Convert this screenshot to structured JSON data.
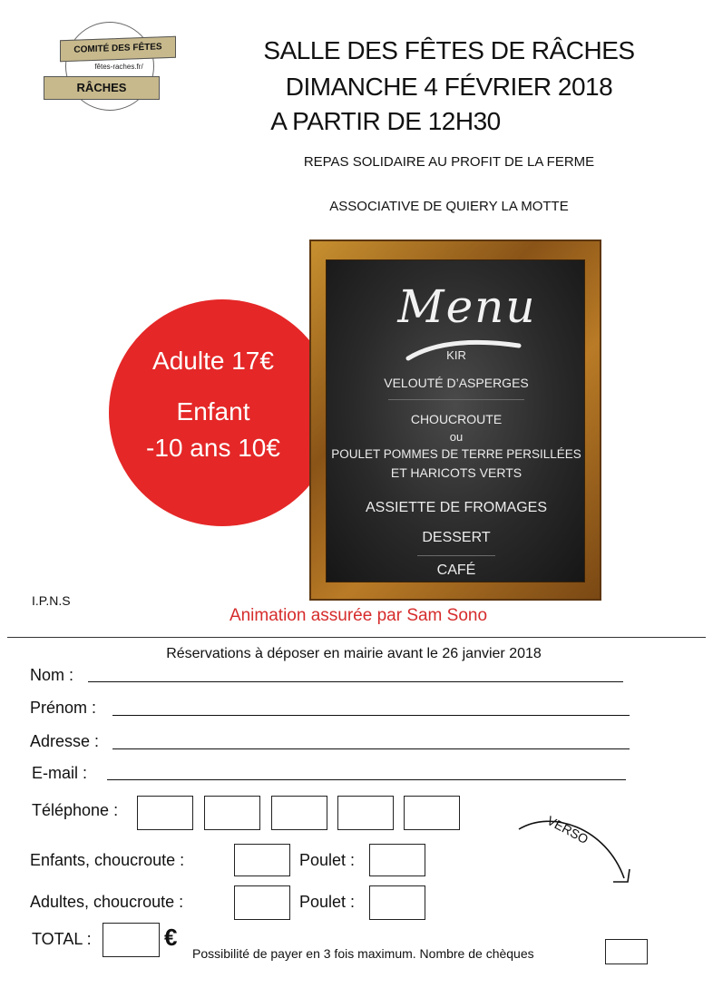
{
  "logo": {
    "top_text": "COMITÉ DES FÊTES",
    "url": "fêtes-raches.fr/",
    "bottom_text": "RÂCHES"
  },
  "header": {
    "line1": "SALLE DES FÊTES DE RÂCHES",
    "line2": "DIMANCHE 4 FÉVRIER 2018",
    "line3": "A PARTIR DE 12H30",
    "sub1": "REPAS SOLIDAIRE AU PROFIT DE LA FERME",
    "sub2": "ASSOCIATIVE DE QUIERY LA MOTTE"
  },
  "prices": {
    "adult": "Adulte 17€",
    "child_line1": "Enfant",
    "child_line2": "-10 ans  10€",
    "circle_color": "#e52727"
  },
  "menu": {
    "title": "Menu",
    "kir": "KIR",
    "veloute": "VELOUTÉ D’ASPERGES",
    "choucroute": "CHOUCROUTE",
    "ou": "ou",
    "poulet": "POULET POMMES DE TERRE PERSILLÉES",
    "haricots": "ET HARICOTS VERTS",
    "fromages": "ASSIETTE DE FROMAGES",
    "dessert": "DESSERT",
    "cafe": "CAFÉ"
  },
  "ipns": "I.P.N.S",
  "animation": "Animation assurée par Sam Sono",
  "form": {
    "reservation_note": "Réservations à déposer en mairie avant le 26  janvier 2018",
    "nom_label": "Nom :",
    "prenom_label": "Prénom :",
    "adresse_label": "Adresse :",
    "email_label": "E-mail :",
    "telephone_label": "Téléphone :",
    "enfants_label": "Enfants, choucroute :",
    "adultes_label": "Adultes, choucroute :",
    "poulet_label": "Poulet :",
    "total_label": "TOTAL :",
    "euro_symbol": "€",
    "cheques_note": "Possibilité de payer en 3 fois maximum. Nombre de chèques",
    "verso": "VERSO"
  }
}
